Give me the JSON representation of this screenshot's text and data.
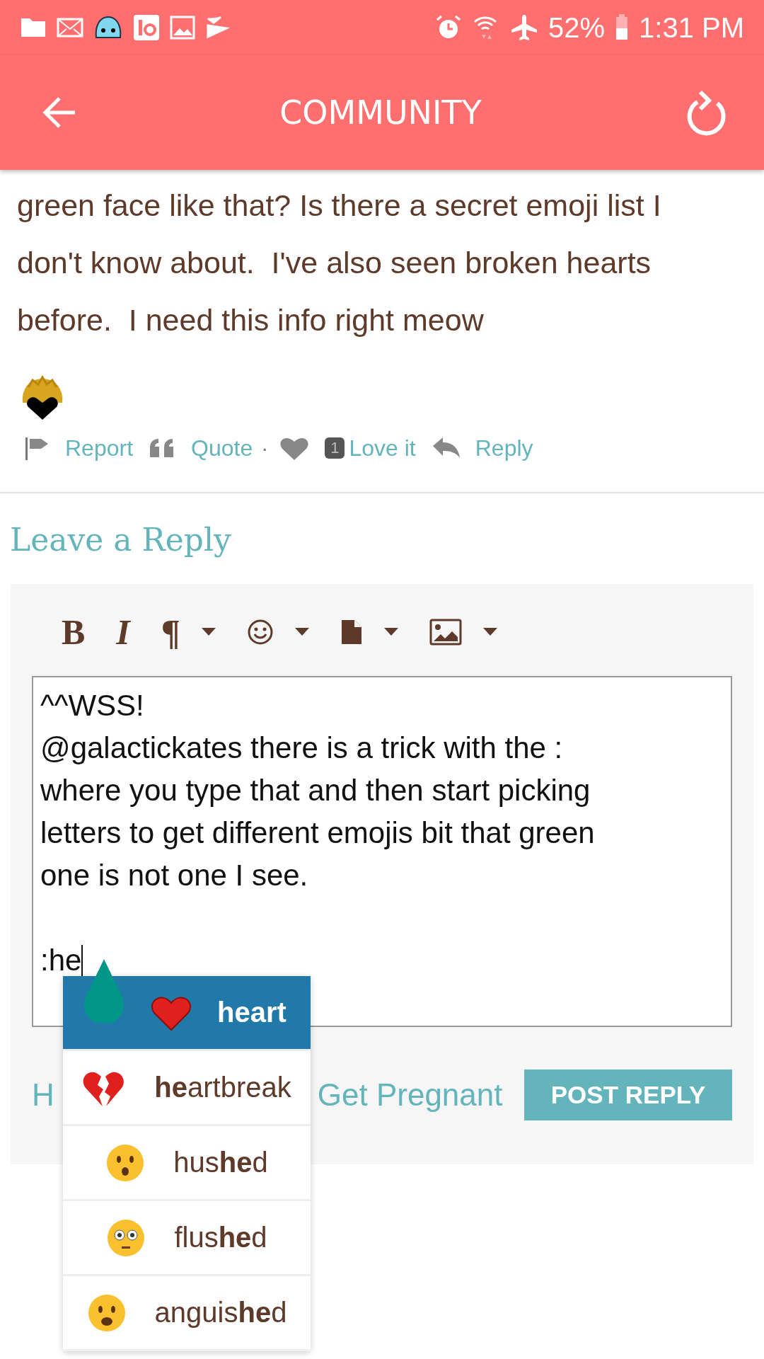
{
  "status_bar": {
    "battery": "52%",
    "time": "1:31 PM"
  },
  "app_bar": {
    "title": "COMMUNITY"
  },
  "post": {
    "text": "green face like that? Is there a secret emoji list I don't know about.  I've also seen broken hearts before.  I need this info right meow",
    "actions": [
      {
        "kind": "report",
        "label": "Report"
      },
      {
        "kind": "quote",
        "label": "Quote"
      },
      {
        "kind": "separator",
        "label": "·"
      },
      {
        "kind": "love",
        "count": "1",
        "label": "Love it"
      },
      {
        "kind": "reply",
        "label": "Reply"
      }
    ]
  },
  "reply_form": {
    "heading": "Leave a Reply",
    "toolbar": [
      {
        "kind": "glyph",
        "label": "B",
        "dropdown": false
      },
      {
        "kind": "glyph",
        "label": "I",
        "dropdown": false
      },
      {
        "kind": "glyph",
        "label": "¶",
        "dropdown": true
      },
      {
        "kind": "emoji",
        "dropdown": true
      },
      {
        "kind": "file",
        "dropdown": true
      },
      {
        "kind": "image",
        "dropdown": true
      }
    ],
    "editor_lines": [
      "^^WSS!",
      "@galactickates there is a trick with the :",
      "where you type that and then start picking",
      "letters to get different emojis bit that green",
      "one is not one I see."
    ],
    "editor_typed": ":he",
    "link_parts": [
      "H",
      "Get Pregnant"
    ],
    "submit": "POST REPLY",
    "suggestions": [
      {
        "kind": "heart",
        "label": "**he**art",
        "selected": true
      },
      {
        "kind": "brokenheart",
        "label": "**he**artbreak",
        "selected": false
      },
      {
        "kind": "hushed",
        "label": "hus**he**d",
        "selected": false
      },
      {
        "kind": "flushed",
        "label": "flus**he**d",
        "selected": false
      },
      {
        "kind": "anguished",
        "label": "anguis**he**d",
        "selected": false
      }
    ]
  }
}
